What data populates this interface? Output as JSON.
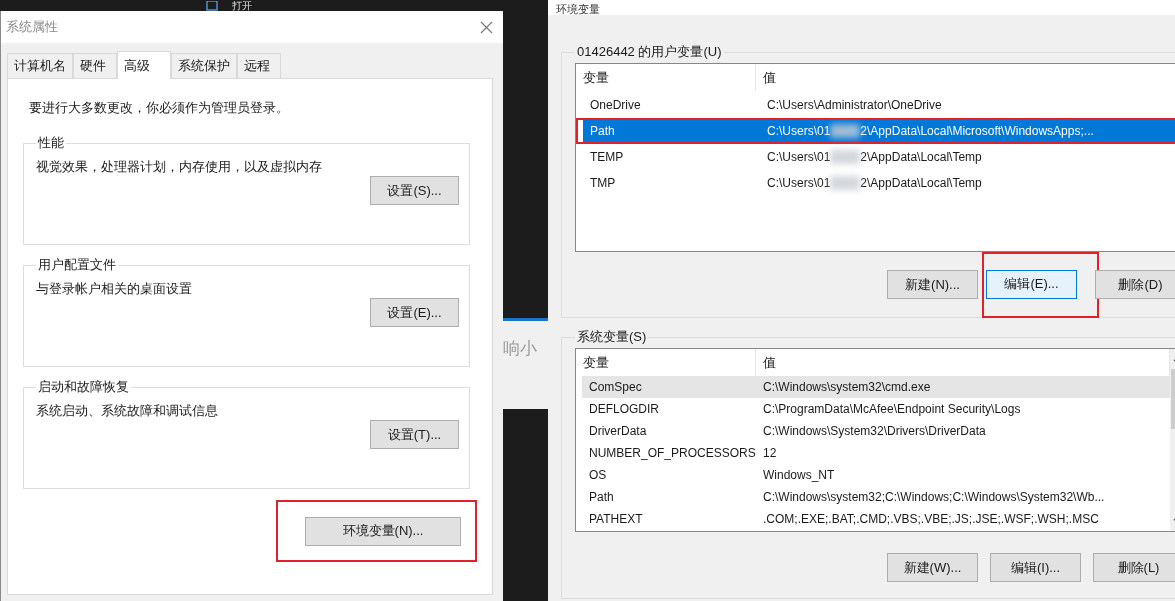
{
  "background": {
    "menu_item": "打开",
    "side_text": "响小"
  },
  "system_properties": {
    "title": "系统属性",
    "tabs": [
      {
        "label": "计算机名",
        "selected": false
      },
      {
        "label": "硬件",
        "selected": false
      },
      {
        "label": "高级",
        "selected": true
      },
      {
        "label": "系统保护",
        "selected": false
      },
      {
        "label": "远程",
        "selected": false
      }
    ],
    "admin_note": "要进行大多数更改，你必须作为管理员登录。",
    "groups": [
      {
        "title": "性能",
        "description": "视觉效果，处理器计划，内存使用，以及虚拟内存",
        "button": "设置(S)..."
      },
      {
        "title": "用户配置文件",
        "description": "与登录帐户相关的桌面设置",
        "button": "设置(E)..."
      },
      {
        "title": "启动和故障恢复",
        "description": "系统启动、系统故障和调试信息",
        "button": "设置(T)..."
      }
    ],
    "env_button": {
      "label": "环境变量(N)...",
      "highlighted": true
    }
  },
  "environment_variables": {
    "title": "环境变量",
    "user_group": {
      "title": "01426442 的用户变量(U)",
      "columns": [
        "变量",
        "值"
      ],
      "rows": [
        {
          "name": "OneDrive",
          "value": "C:\\Users\\Administrator\\OneDrive",
          "redacted": false,
          "selected": false,
          "highlighted": false
        },
        {
          "name": "Path",
          "value": "C:\\Users\\01",
          "value_after": "2\\AppData\\Local\\Microsoft\\WindowsApps;...",
          "redacted": true,
          "selected": true,
          "highlighted": true
        },
        {
          "name": "TEMP",
          "value": "C:\\Users\\01",
          "value_after": "2\\AppData\\Local\\Temp",
          "redacted": true,
          "selected": false,
          "highlighted": false
        },
        {
          "name": "TMP",
          "value": "C:\\Users\\01",
          "value_after": "2\\AppData\\Local\\Temp",
          "redacted": true,
          "selected": false,
          "highlighted": false
        }
      ],
      "buttons": [
        {
          "label": "新建(N)...",
          "focused": false,
          "highlighted": false
        },
        {
          "label": "编辑(E)...",
          "focused": true,
          "highlighted": true
        },
        {
          "label": "删除(D)",
          "focused": false,
          "highlighted": false
        }
      ]
    },
    "system_group": {
      "title": "系统变量(S)",
      "columns": [
        "变量",
        "值"
      ],
      "rows": [
        {
          "name": "ComSpec",
          "value": "C:\\Windows\\system32\\cmd.exe",
          "hovered": true
        },
        {
          "name": "DEFLOGDIR",
          "value": "C:\\ProgramData\\McAfee\\Endpoint Security\\Logs",
          "hovered": false
        },
        {
          "name": "DriverData",
          "value": "C:\\Windows\\System32\\Drivers\\DriverData",
          "hovered": false
        },
        {
          "name": "NUMBER_OF_PROCESSORS",
          "value": "12",
          "hovered": false
        },
        {
          "name": "OS",
          "value": "Windows_NT",
          "hovered": false
        },
        {
          "name": "Path",
          "value": "C:\\Windows\\system32;C:\\Windows;C:\\Windows\\System32\\Wb...",
          "hovered": false
        },
        {
          "name": "PATHEXT",
          "value": ".COM;.EXE;.BAT;.CMD;.VBS;.VBE;.JS;.JSE;.WSF;.WSH;.MSC",
          "hovered": false
        }
      ],
      "buttons": [
        {
          "label": "新建(W)...",
          "focused": false,
          "highlighted": false
        },
        {
          "label": "编辑(I)...",
          "focused": false,
          "highlighted": false
        },
        {
          "label": "删除(L)",
          "focused": false,
          "highlighted": false
        }
      ]
    }
  }
}
